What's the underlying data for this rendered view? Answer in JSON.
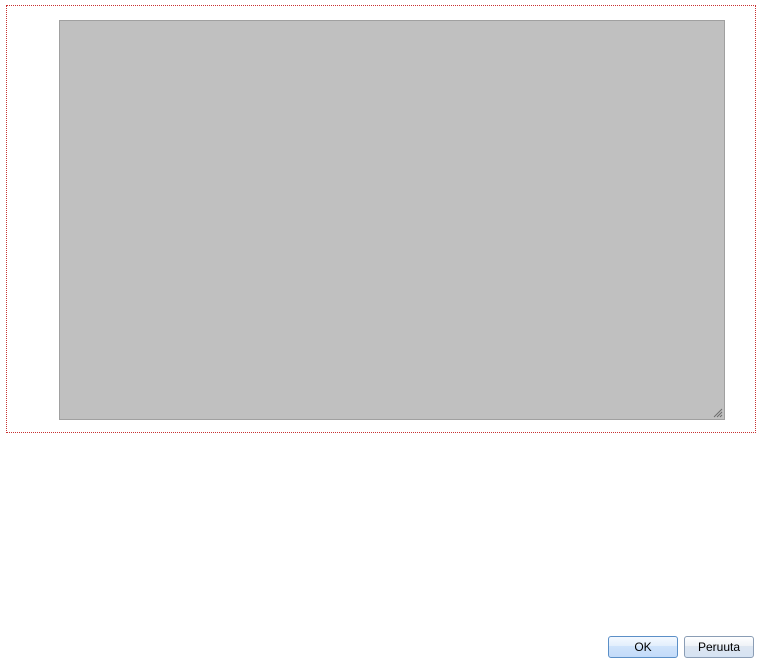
{
  "textarea": {
    "value": "",
    "placeholder": ""
  },
  "buttons": {
    "ok_label": "OK",
    "cancel_label": "Peruuta"
  },
  "colors": {
    "panel_border": "#c83232",
    "textarea_bg": "#c0c0c0"
  }
}
